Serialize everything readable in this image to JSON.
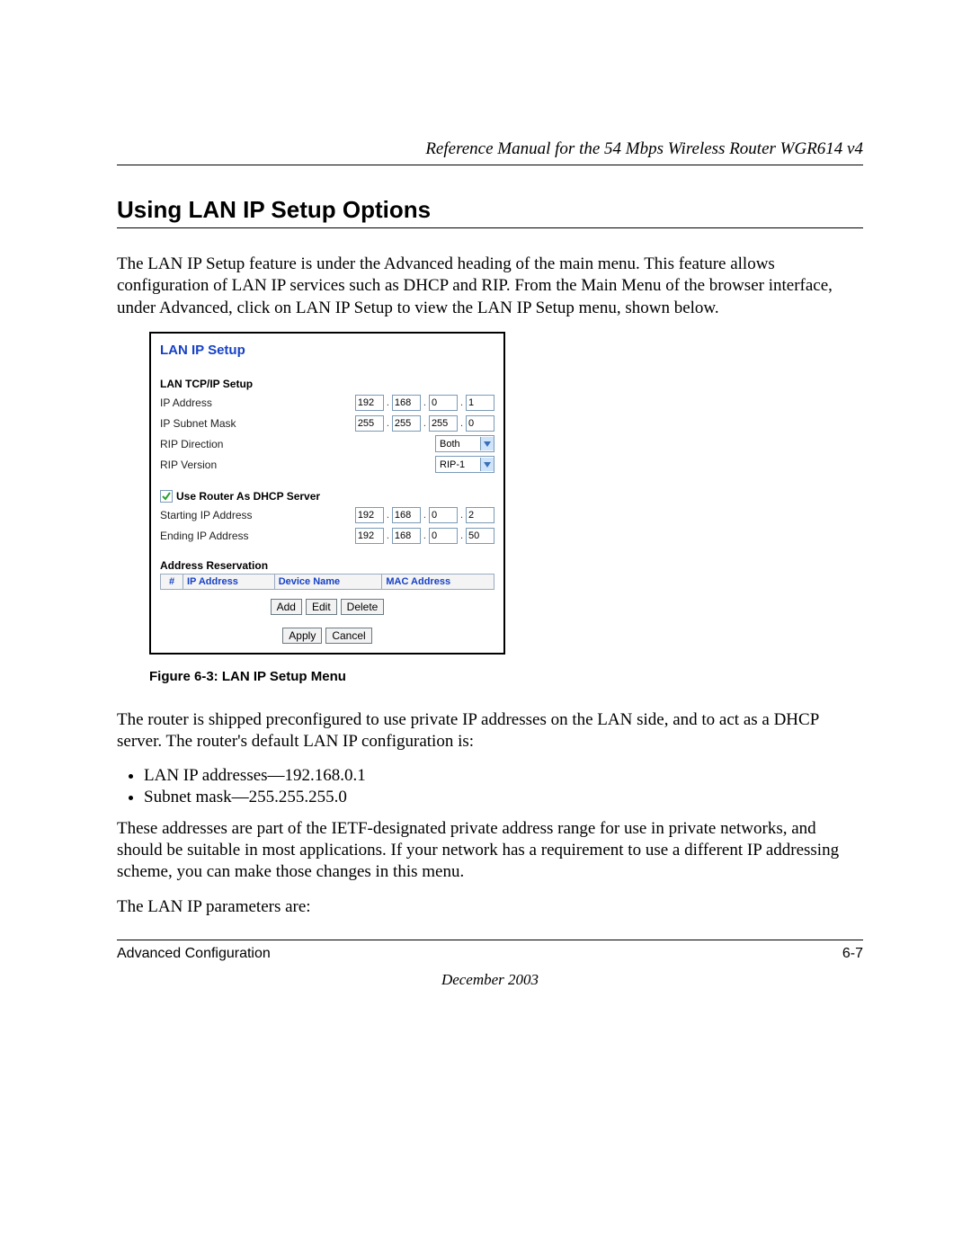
{
  "header": {
    "running_head": "Reference Manual for the 54 Mbps Wireless Router WGR614 v4"
  },
  "section": {
    "title": "Using LAN IP Setup Options",
    "para1": "The LAN IP Setup feature is under the Advanced heading of the main menu. This feature allows configuration of LAN IP services such as DHCP and RIP. From the Main Menu of the browser interface, under Advanced, click on LAN IP Setup to view the LAN IP Setup menu, shown below."
  },
  "figure": {
    "caption": "Figure 6-3:  LAN IP Setup Menu",
    "ui": {
      "title": "LAN IP Setup",
      "tcpip_label": "LAN TCP/IP Setup",
      "ip_address_label": "IP Address",
      "ip_address": [
        "192",
        "168",
        "0",
        "1"
      ],
      "subnet_label": "IP Subnet Mask",
      "subnet": [
        "255",
        "255",
        "255",
        "0"
      ],
      "rip_dir_label": "RIP Direction",
      "rip_dir_value": "Both",
      "rip_ver_label": "RIP Version",
      "rip_ver_value": "RIP-1",
      "dhcp_checkbox_label": "Use Router As DHCP Server",
      "start_ip_label": "Starting IP Address",
      "start_ip": [
        "192",
        "168",
        "0",
        "2"
      ],
      "end_ip_label": "Ending IP Address",
      "end_ip": [
        "192",
        "168",
        "0",
        "50"
      ],
      "addr_res_label": "Address Reservation",
      "col_idx": "#",
      "col_ip": "IP Address",
      "col_dev": "Device Name",
      "col_mac": "MAC Address",
      "btn_add": "Add",
      "btn_edit": "Edit",
      "btn_delete": "Delete",
      "btn_apply": "Apply",
      "btn_cancel": "Cancel"
    }
  },
  "after_figure": {
    "para2": "The router is shipped preconfigured to use private IP addresses on the LAN side, and to act as a DHCP server. The router's default LAN IP configuration is:",
    "bullets": [
      "LAN IP addresses—192.168.0.1",
      "Subnet mask—255.255.255.0"
    ],
    "para3": "These addresses are part of the IETF-designated private address range for use in private networks, and should be suitable in most applications. If your network has a requirement to use a different IP addressing scheme, you can make those changes in this menu.",
    "para4": "The LAN IP parameters are:"
  },
  "footer": {
    "left": "Advanced Configuration",
    "right": "6-7",
    "date": "December 2003"
  }
}
